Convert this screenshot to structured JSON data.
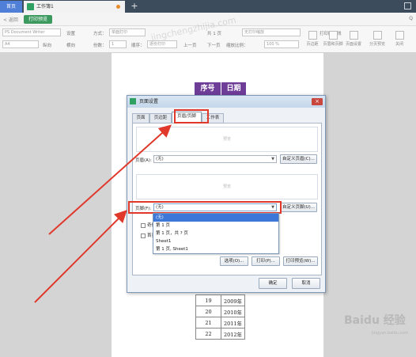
{
  "tabbar": {
    "home": "首页",
    "document": "工作簿1",
    "add": "+"
  },
  "menu": {
    "back": "< 返回",
    "active": "打印预览",
    "right": "Q"
  },
  "toolbar": {
    "printer": "PS Document Writer",
    "settings": "设置",
    "style_label": "方式：",
    "style_value": "单面打印",
    "paper": "A4",
    "portrait": "纵向",
    "landscape": "横向",
    "copies_label": "份数：",
    "copies_value": "1",
    "order_label": "顺序：",
    "order_value": "逐份打印",
    "prev_page": "上一页",
    "next_page": "下一页",
    "page_count": "共 1 页",
    "zoom_label": "缩放比例：",
    "zoom_value": "100 %",
    "no_scale": "无打印缩放",
    "print_gridlines": "打印网格线",
    "margins": "页边距",
    "header_footer": "页眉和页脚",
    "page_setup": "页面设置",
    "mode": "分页预览",
    "close": "关闭"
  },
  "sheet": {
    "col1": "序号",
    "col2": "日期",
    "rows": [
      [
        "19",
        "2009年"
      ],
      [
        "20",
        "2010年"
      ],
      [
        "21",
        "2011年"
      ],
      [
        "22",
        "2012年"
      ]
    ]
  },
  "dialog": {
    "title": "页面设置",
    "close": "×",
    "tabs": [
      "页面",
      "页边距",
      "页眉/页脚",
      "工作表"
    ],
    "preview_header": "预览",
    "preview_footer": "预览",
    "header_label": "页眉(A):",
    "header_value": "(无)",
    "custom_header": "自定义页眉(C)...",
    "footer_label": "页脚(F):",
    "footer_value": "(无)",
    "custom_footer": "自定义页脚(U)...",
    "dropdown_options": [
      "(无)",
      "第 1 页",
      "第 1 页，共 ? 页",
      "Sheet1",
      "第 1 页, Sheet1"
    ],
    "check1": "奇偶页",
    "check2": "首页不",
    "options_btn": "选项(O)...",
    "print_btn": "打印(P)...",
    "print_preview_btn": "打印预览(W)...",
    "ok": "确定",
    "cancel": "取消"
  },
  "watermark": {
    "logo": "Baidu 经验",
    "sub": "jingyan.baidu.com",
    "diagonal": "jingchengzhijia.com"
  }
}
